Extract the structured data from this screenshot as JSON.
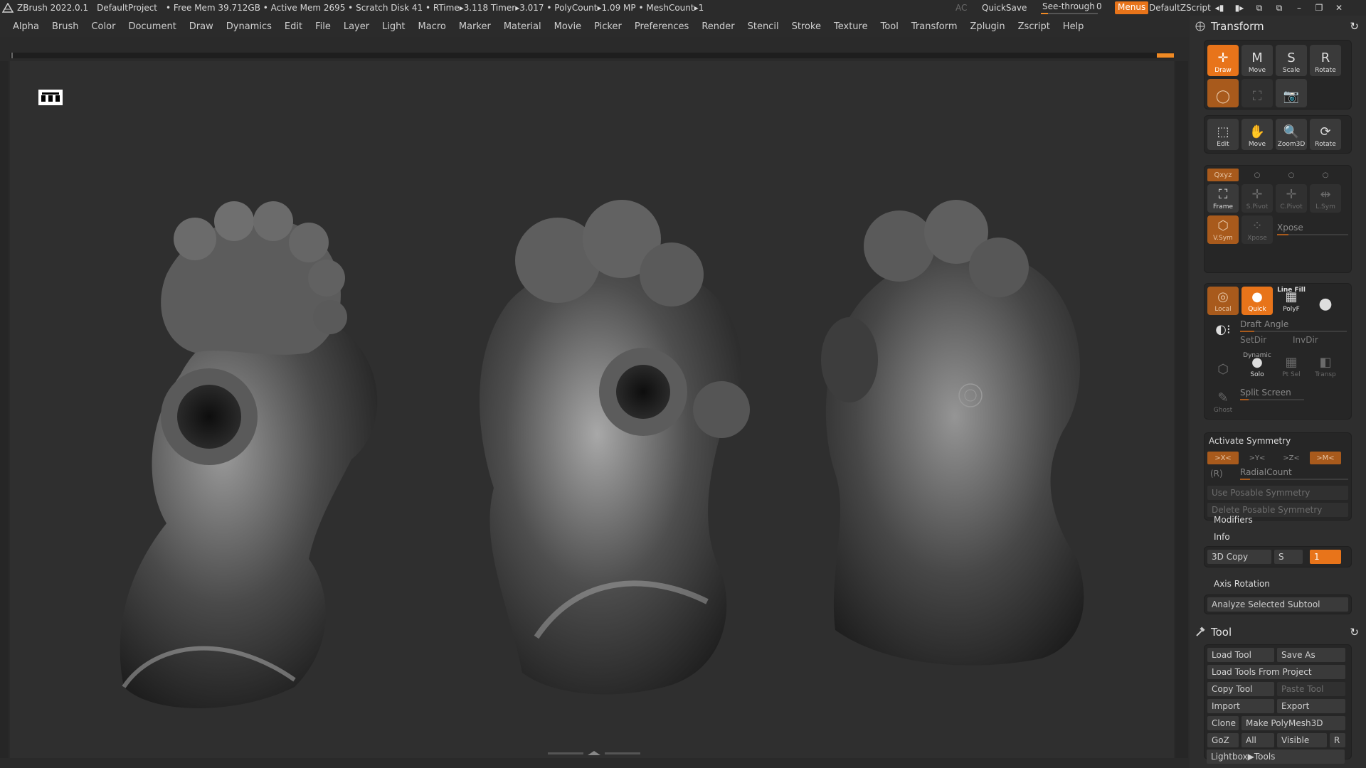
{
  "titlebar": {
    "app": "ZBrush 2022.0.1",
    "project": "DefaultProject",
    "stats": "• Free Mem 39.712GB • Active Mem 2695 • Scratch Disk 41 •  RTime▸3.118 Timer▸3.017 • PolyCount▸1.09 MP  • MeshCount▸1",
    "ac": "AC",
    "quicksave": "QuickSave",
    "seethrough_label": "See-through",
    "seethrough_value": "0",
    "menus": "Menus",
    "default_script": "DefaultZScript"
  },
  "menubar": [
    "Alpha",
    "Brush",
    "Color",
    "Document",
    "Draw",
    "Dynamics",
    "Edit",
    "File",
    "Layer",
    "Light",
    "Macro",
    "Marker",
    "Material",
    "Movie",
    "Picker",
    "Preferences",
    "Render",
    "Stencil",
    "Stroke",
    "Texture",
    "Tool",
    "Transform",
    "Zplugin",
    "Zscript",
    "Help"
  ],
  "transform": {
    "title": "Transform",
    "buttons_row1": [
      "Draw",
      "Move",
      "Scale",
      "Rotate"
    ],
    "buttons_row2_labels": [
      "Edit",
      "Move",
      "Zoom3D",
      "Rotate"
    ],
    "axes_label": "Qxyz",
    "frame": "Frame",
    "spivot": "S.Pivot",
    "cpivot": "C.Pivot",
    "lsym": "L.Sym",
    "vsym": "V.Sym",
    "xpose_small": "Xpose",
    "xpose": "Xpose",
    "local": "Local",
    "quick": "Quick",
    "linefill": "Line Fill",
    "polyf": "PolyF",
    "draft_angle": "Draft Angle",
    "setdir": "SetDir",
    "invdir": "InvDir",
    "dynamic": "Dynamic",
    "solo": "Solo",
    "ptsel": "Pt Sel",
    "transp": "Transp",
    "split_screen": "Split Screen",
    "ghost": "Ghost",
    "activate_symmetry": "Activate Symmetry",
    "sym_x": ">X<",
    "sym_y": ">Y<",
    "sym_z": ">Z<",
    "sym_m": ">M<",
    "sym_r": "(R)",
    "radial_count": "RadialCount",
    "use_posable": "Use Posable Symmetry",
    "delete_posable": "Delete Posable Symmetry",
    "modifiers": "Modifiers",
    "info": "Info",
    "copy3d": "3D Copy",
    "copy3d_s": "S",
    "copy3d_val": "1",
    "axis_rotation": "Axis Rotation",
    "analyze": "Analyze Selected Subtool"
  },
  "tool": {
    "title": "Tool",
    "load_tool": "Load Tool",
    "save_as": "Save As",
    "load_from_project": "Load Tools From Project",
    "copy_tool": "Copy Tool",
    "paste_tool": "Paste Tool",
    "import": "Import",
    "export": "Export",
    "clone": "Clone",
    "make_polymesh": "Make PolyMesh3D",
    "goz": "GoZ",
    "all": "All",
    "visible": "Visible",
    "r": "R",
    "lightbox_tools": "Lightbox▶Tools"
  },
  "colors": {
    "accent": "#e8741a",
    "panel": "#2e2e2e",
    "viewport": "#2f2f2f"
  }
}
